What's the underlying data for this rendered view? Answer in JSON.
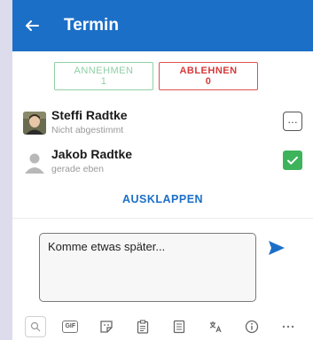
{
  "header": {
    "title": "Termin",
    "back_icon": "arrow-left-icon",
    "background": "#1c6fc7"
  },
  "rsvp": {
    "accept": {
      "label": "ANNEHMEN",
      "count": "1",
      "color": "#8fd0a4"
    },
    "decline": {
      "label": "ABLEHNEN",
      "count": "0",
      "color": "#d63a3a"
    }
  },
  "participants": [
    {
      "name": "Steffi Radtke",
      "status": "Nicht abgestimmt",
      "state_icon": "pending-dots-icon"
    },
    {
      "name": "Jakob Radtke",
      "status": "gerade eben",
      "state_icon": "checkmark-icon",
      "state_color": "#3db35c"
    }
  ],
  "expand_label": "AUSKLAPPEN",
  "compose": {
    "text": "Komme etwas später...",
    "send_icon": "send-icon"
  },
  "toolbar": {
    "icons": [
      "search-icon",
      "gif-icon",
      "sticker-icon",
      "clipboard-icon",
      "list-icon",
      "translate-icon",
      "info-icon",
      "more-icon"
    ],
    "gif_label": "GIF"
  }
}
